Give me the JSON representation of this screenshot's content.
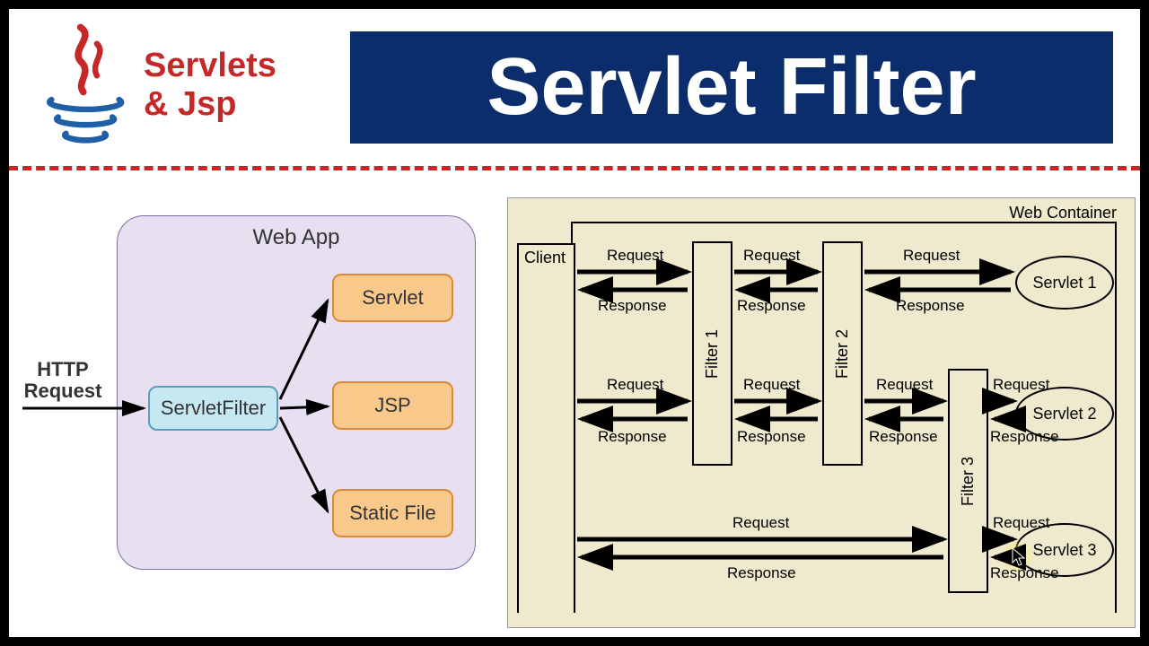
{
  "header": {
    "logo_line1": "Servlets",
    "logo_line2": "& Jsp",
    "title": "Servlet Filter"
  },
  "left": {
    "container_title": "Web App",
    "incoming": "HTTP\nRequest",
    "filter": "ServletFilter",
    "targets": [
      "Servlet",
      "JSP",
      "Static File"
    ]
  },
  "right": {
    "container_title": "Web Container",
    "client": "Client",
    "filters": [
      "Filter 1",
      "Filter 2",
      "Filter 3"
    ],
    "servlets": [
      "Servlet 1",
      "Servlet 2",
      "Servlet 3"
    ],
    "request": "Request",
    "response": "Response"
  }
}
